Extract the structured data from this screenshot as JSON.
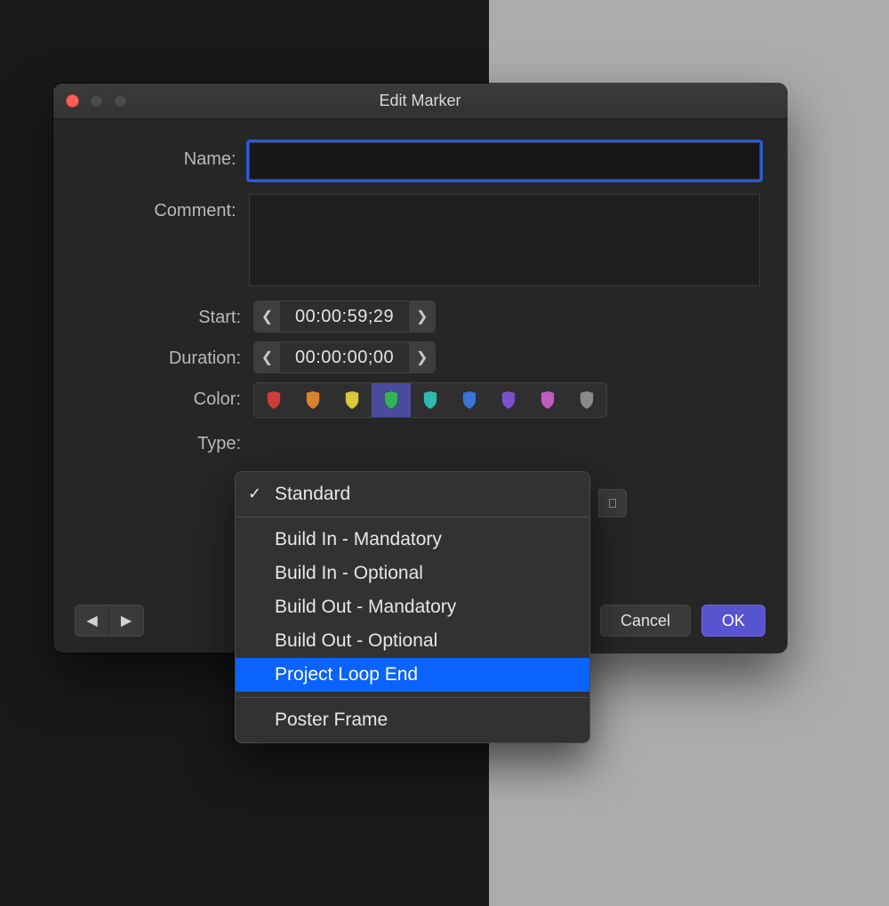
{
  "window": {
    "title": "Edit Marker"
  },
  "labels": {
    "name": "Name:",
    "comment": "Comment:",
    "start": "Start:",
    "duration": "Duration:",
    "color": "Color:",
    "type": "Type:"
  },
  "fields": {
    "name": "",
    "comment": "",
    "start": "00:00:59;29",
    "duration": "00:00:00;00"
  },
  "colors": {
    "options": [
      {
        "name": "red",
        "hex": "#cd3e3b"
      },
      {
        "name": "orange",
        "hex": "#d8822f"
      },
      {
        "name": "yellow",
        "hex": "#d8c83a"
      },
      {
        "name": "green",
        "hex": "#35b356"
      },
      {
        "name": "teal",
        "hex": "#2fb8b0"
      },
      {
        "name": "blue",
        "hex": "#3b73d6"
      },
      {
        "name": "purple",
        "hex": "#7a52c6"
      },
      {
        "name": "magenta",
        "hex": "#c05bc0"
      },
      {
        "name": "gray",
        "hex": "#8a8a8a"
      }
    ],
    "selected_index": 3
  },
  "type_menu": {
    "selected": "Standard",
    "highlighted": "Project Loop End",
    "groups": [
      [
        "Standard"
      ],
      [
        "Build In - Mandatory",
        "Build In - Optional",
        "Build Out - Mandatory",
        "Build Out - Optional",
        "Project Loop End"
      ],
      [
        "Poster Frame"
      ]
    ]
  },
  "buttons": {
    "cancel": "Cancel",
    "ok": "OK"
  },
  "glyphs": {
    "tri_left": "◀",
    "tri_right": "▶",
    "chev_left": "❮",
    "chev_right": "❯",
    "check": "✓",
    "updown": "⌃"
  }
}
